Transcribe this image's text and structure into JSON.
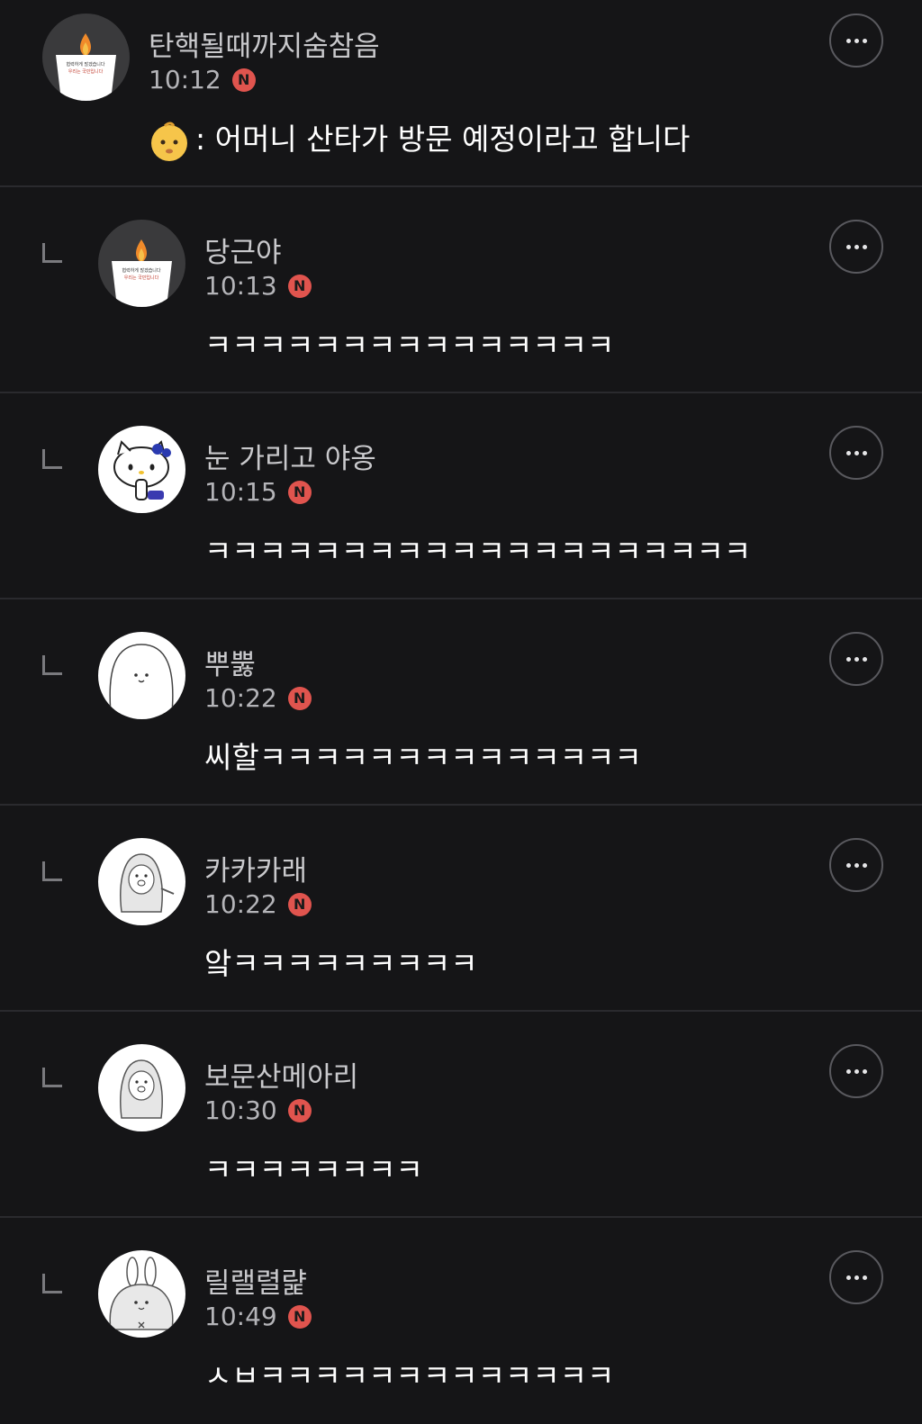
{
  "comments": [
    {
      "name": "탄핵될때까지숨참음",
      "time": "10:12",
      "badge": "N",
      "text": ": 어머니 산타가 방문 예정이라고 합니다",
      "avatar_icon": "candle-protest-icon",
      "is_reply": false
    },
    {
      "name": "당근야",
      "time": "10:13",
      "badge": "N",
      "text": "ㅋㅋㅋㅋㅋㅋㅋㅋㅋㅋㅋㅋㅋㅋㅋ",
      "avatar_icon": "candle-protest-icon",
      "is_reply": true
    },
    {
      "name": "눈 가리고 야옹",
      "time": "10:15",
      "badge": "N",
      "text": "ㅋㅋㅋㅋㅋㅋㅋㅋㅋㅋㅋㅋㅋㅋㅋㅋㅋㅋㅋㅋ",
      "avatar_icon": "hello-kitty-icon",
      "is_reply": true
    },
    {
      "name": "뿌뿛",
      "time": "10:22",
      "badge": "N",
      "text": "씨할ㅋㅋㅋㅋㅋㅋㅋㅋㅋㅋㅋㅋㅋㅋ",
      "avatar_icon": "round-blob-character-icon",
      "is_reply": true
    },
    {
      "name": "카카카래",
      "time": "10:22",
      "badge": "N",
      "text": "앜ㅋㅋㅋㅋㅋㅋㅋㅋㅋ",
      "avatar_icon": "hooded-character-icon",
      "is_reply": true
    },
    {
      "name": "보문산메아리",
      "time": "10:30",
      "badge": "N",
      "text": "ㅋㅋㅋㅋㅋㅋㅋㅋ",
      "avatar_icon": "hooded-character-icon",
      "is_reply": true
    },
    {
      "name": "릴랠렬럁",
      "time": "10:49",
      "badge": "N",
      "text": "ㅅㅂㅋㅋㅋㅋㅋㅋㅋㅋㅋㅋㅋㅋㅋ",
      "avatar_icon": "bunny-character-icon",
      "is_reply": true
    }
  ],
  "avatar_caption": {
    "line1": "협력하게 많겠습니다",
    "line2": "우리는 국민입니다"
  },
  "colors": {
    "background": "#151517",
    "badge": "#e0544e",
    "divider": "#2a2a2e"
  }
}
